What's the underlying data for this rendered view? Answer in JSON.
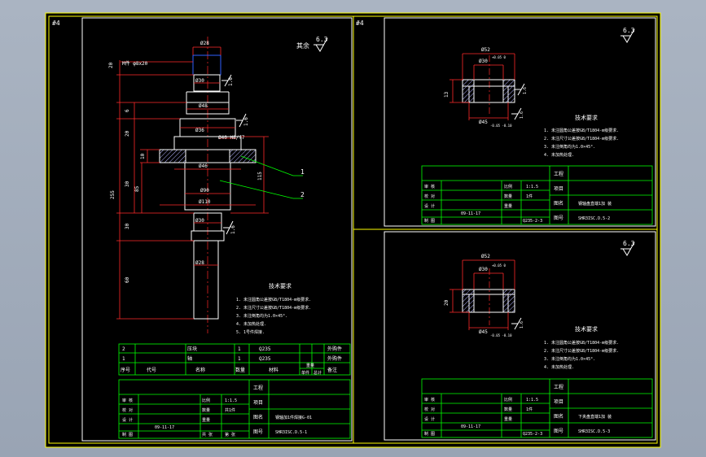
{
  "colors": {
    "background": "#000000",
    "frame": "#ffff00",
    "outline": "#ffffff",
    "dimension": "#ff2a2a",
    "hatch": "#b3b3ff",
    "leader": "#00ff00",
    "table": "#00ff00",
    "text": "#ffffff",
    "blue": "#3060ff"
  },
  "sheets": {
    "main_tag": "#4",
    "right_top_tag": "#4",
    "main_roughness": "6.3",
    "main_roughness_prefix": "其余",
    "right_top_roughness": "6.3",
    "right_bottom_roughness": "6.3"
  },
  "shaft": {
    "dims": {
      "d_top": "Ø28",
      "thread": "M件 φ8x20",
      "d1": "Ø30",
      "d2": "Ø48",
      "d3": "Ø36",
      "fit": "Ø40 H8/f7",
      "d4": "Ø46",
      "d5": "Ø90",
      "d6": "Ø110",
      "d7": "Ø30",
      "d8": "Ø28",
      "v20": "20",
      "v20b": "20",
      "v30": "30",
      "v30b": "30",
      "v60": "60",
      "v255": "255",
      "v10": "10",
      "v85": "85",
      "v115": "115",
      "v6": "6"
    },
    "callouts": [
      "1",
      "2"
    ],
    "roughness_marks": [
      "1.6",
      "1.6",
      "1.6"
    ],
    "tech_title": "技术要求",
    "tech_notes": [
      "1. 未注圆角公差按GB/T1804-m级要求.",
      "2. 未注尺寸公差按GB/T1804-m级要求.",
      "3. 未注倒角均为1.0×45°.",
      "4. 未加热处理.",
      "5. 1号件焊接."
    ]
  },
  "bom": {
    "rows": [
      {
        "no": "2",
        "name": "压块",
        "qty": "1",
        "mat": "Q235",
        "note": "外购件"
      },
      {
        "no": "1",
        "name": "轴",
        "qty": "1",
        "mat": "Q235",
        "note": "外购件"
      }
    ],
    "header": [
      "序号",
      "代号",
      "名称",
      "数量",
      "材料",
      "单件",
      "总计",
      "备注"
    ],
    "header_weight": "重量"
  },
  "title_main": {
    "project_label": "工程",
    "item_label": "项目",
    "name_label": "图名",
    "number_label": "图号",
    "name": "钢轴加1件焊接G-01",
    "number": "SHR3ISC.D.5-1",
    "left_labels": [
      "审 核",
      "校 对",
      "设 计",
      "制 图"
    ],
    "date": "09-11-17",
    "scale_label": "比例",
    "scale": "1:1.5",
    "qty_label": "数量",
    "qty": "共1件",
    "weight_label": "重量",
    "sheet_label": "共 张",
    "sheet2_label": "第 张"
  },
  "part_top": {
    "dims": {
      "outer": "Ø52",
      "inner": "Ø30",
      "inner_tol": "+0.05 0",
      "height": "13",
      "base": "Ø45",
      "base_tol": "-0.05 -0.10"
    },
    "roughness_marks": [
      "1.6",
      "1.6"
    ],
    "tech_title": "技术要求",
    "tech_notes": [
      "1. 未注圆角公差按GB/T1804-m级要求.",
      "2. 未注尺寸公差按GB/T1804-m级要求.",
      "3. 未注倒角均为1.0×45°.",
      "4. 未加热处理."
    ],
    "title": {
      "project_label": "工程",
      "item_label": "项目",
      "name_label": "图名",
      "number_label": "图号",
      "name": "钢轴盘直端1加 装",
      "number": "SHR3ISC.D.5-2",
      "left_labels": [
        "审 核",
        "校 对",
        "设 计",
        "制 图"
      ],
      "date": "09-11-17",
      "scale_label": "比例",
      "scale": "1:1.5",
      "qty_label": "数量",
      "qty": "1件",
      "weight_label": "重量",
      "material": "Q235-2-3"
    }
  },
  "part_bottom": {
    "dims": {
      "outer": "Ø52",
      "inner": "Ø30",
      "inner_tol": "+0.05 0",
      "height": "20",
      "base": "Ø45",
      "base_tol": "-0.05 -0.10"
    },
    "roughness_marks": [
      "1.6"
    ],
    "tech_title": "技术要求",
    "tech_notes": [
      "1. 未注圆角公差按GB/T1804-m级要求.",
      "2. 未注尺寸公差按GB/T1804-m级要求.",
      "3. 未注倒角均为1.0×45°.",
      "4. 未加热处理."
    ],
    "title": {
      "project_label": "工程",
      "item_label": "项目",
      "name_label": "图名",
      "number_label": "图号",
      "name": "下夹盘直端1加 装",
      "number": "SHR3ISC.D.5-3",
      "left_labels": [
        "审 核",
        "校 对",
        "设 计",
        "制 图"
      ],
      "date": "09-11-17",
      "scale_label": "比例",
      "scale": "1:1.5",
      "qty_label": "数量",
      "qty": "1件",
      "weight_label": "重量",
      "material": "Q235-2-3"
    }
  }
}
